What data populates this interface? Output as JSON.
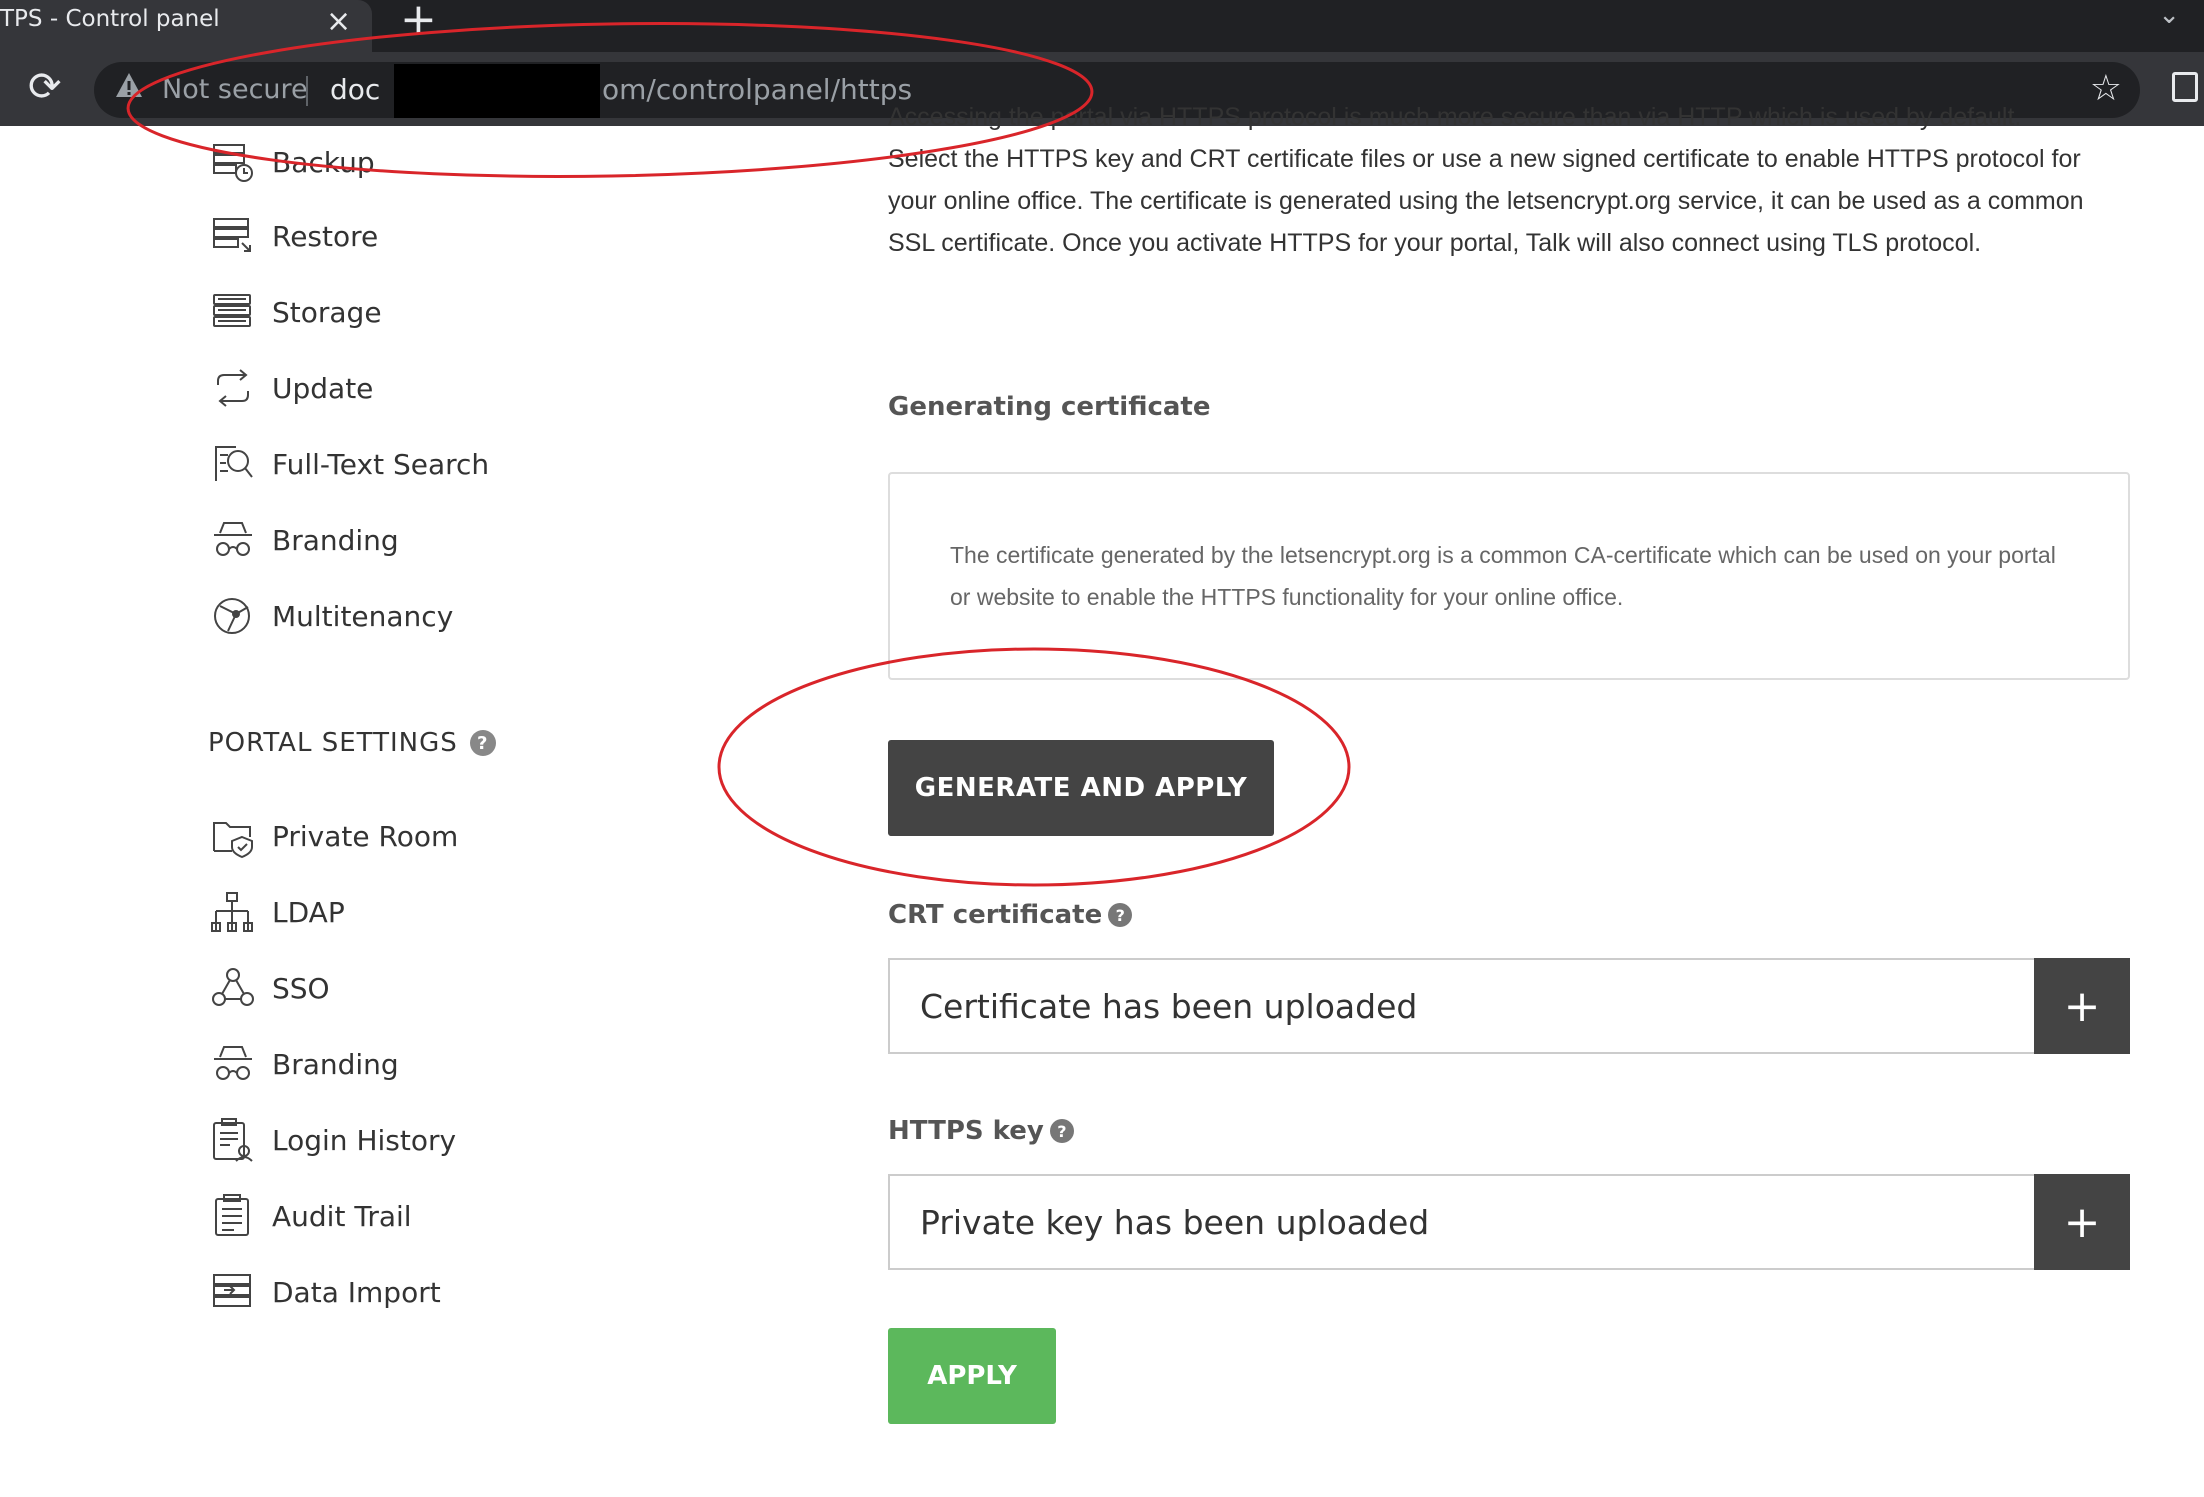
{
  "browser": {
    "tab_title": "TPS - Control panel",
    "tab_close": "×",
    "new_tab": "+",
    "tab_menu": "⌄",
    "reload_icon": "⟳",
    "security_warning": "Not secure",
    "url_host_visible": "doc",
    "url_path_visible": "om/controlpanel/https",
    "bookmark_star": "☆",
    "redaction_color": "#000000"
  },
  "sidebar": {
    "items_top": [
      {
        "label": "Backup",
        "icon": "backup-icon"
      },
      {
        "label": "Restore",
        "icon": "restore-icon"
      },
      {
        "label": "Storage",
        "icon": "storage-icon"
      },
      {
        "label": "Update",
        "icon": "update-icon"
      },
      {
        "label": "Full-Text Search",
        "icon": "search-icon"
      },
      {
        "label": "Branding",
        "icon": "branding-icon"
      },
      {
        "label": "Multitenancy",
        "icon": "multitenancy-icon"
      }
    ],
    "portal_settings_title": "PORTAL SETTINGS",
    "help_mark": "?",
    "items_portal": [
      {
        "label": "Private Room",
        "icon": "private-room-icon"
      },
      {
        "label": "LDAP",
        "icon": "ldap-icon"
      },
      {
        "label": "SSO",
        "icon": "sso-icon"
      },
      {
        "label": "Branding",
        "icon": "branding-icon"
      },
      {
        "label": "Login History",
        "icon": "login-history-icon"
      },
      {
        "label": "Audit Trail",
        "icon": "audit-trail-icon"
      },
      {
        "label": "Data Import",
        "icon": "data-import-icon"
      }
    ]
  },
  "main": {
    "intro_cut": "Accessing the portal via HTTPS protocol is much more secure than via HTTP which is used by default.",
    "intro": "Select the HTTPS key and CRT certificate files or use a new signed certificate to enable HTTPS protocol for your online office. The certificate is generated using the letsencrypt.org service, it can be used as a common SSL certificate. Once you activate HTTPS for your portal, Talk will also connect using TLS protocol.",
    "generating_title": "Generating certificate",
    "generating_info": "The certificate generated by the letsencrypt.org is a common CA-certificate which can be used on your portal or website to enable the HTTPS functionality for your online office.",
    "generate_button": "GENERATE AND APPLY",
    "crt_label": "CRT certificate",
    "crt_value": "Certificate has been uploaded",
    "key_label": "HTTPS key",
    "key_value": "Private key has been uploaded",
    "plus": "+",
    "apply_button": "APPLY"
  },
  "colors": {
    "dark_button": "#444444",
    "apply_button": "#5cb85c",
    "annotation": "#d9252a"
  }
}
